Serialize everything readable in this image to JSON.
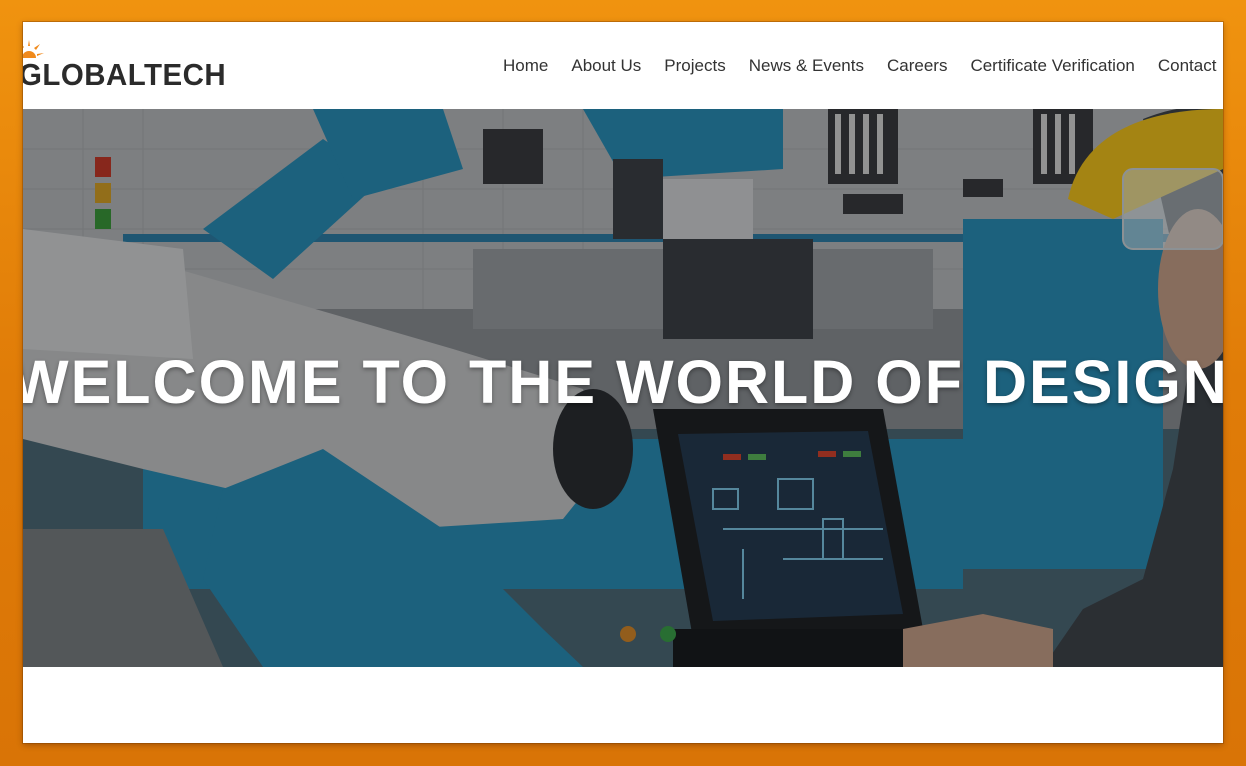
{
  "brand": {
    "name": "GLOBALTECH",
    "accent_color": "#f08a1c",
    "text_color": "#2b2b2b"
  },
  "nav": {
    "items": [
      {
        "label": "Home"
      },
      {
        "label": "About Us"
      },
      {
        "label": "Projects"
      },
      {
        "label": "News & Events"
      },
      {
        "label": "Careers"
      },
      {
        "label": "Certificate Verification"
      },
      {
        "label": "Contact"
      }
    ]
  },
  "hero": {
    "title": "WELCOME TO THE WORLD OF DESIGN"
  },
  "colors": {
    "frame": "#e8850e",
    "page_bg": "#ffffff",
    "hero_robot_blue": "#2a8fb8",
    "hero_overlay": "rgba(0,0,0,0.35)"
  }
}
